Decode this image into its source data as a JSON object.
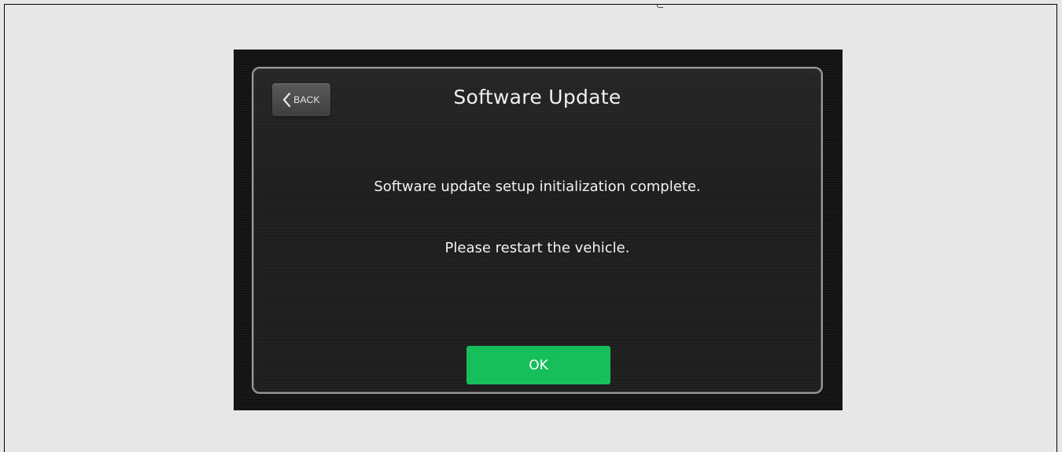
{
  "dialog": {
    "title": "Software Update",
    "back_label": "BACK",
    "message_line_1": "Software update setup initialization complete.",
    "message_line_2": "Please restart the vehicle.",
    "ok_label": "OK"
  },
  "icons": {
    "back": "chevron-left-icon"
  },
  "colors": {
    "ok_button": "#17bf5a",
    "screen_background": "#1b1b1b",
    "page_background": "#e7e7e7"
  }
}
